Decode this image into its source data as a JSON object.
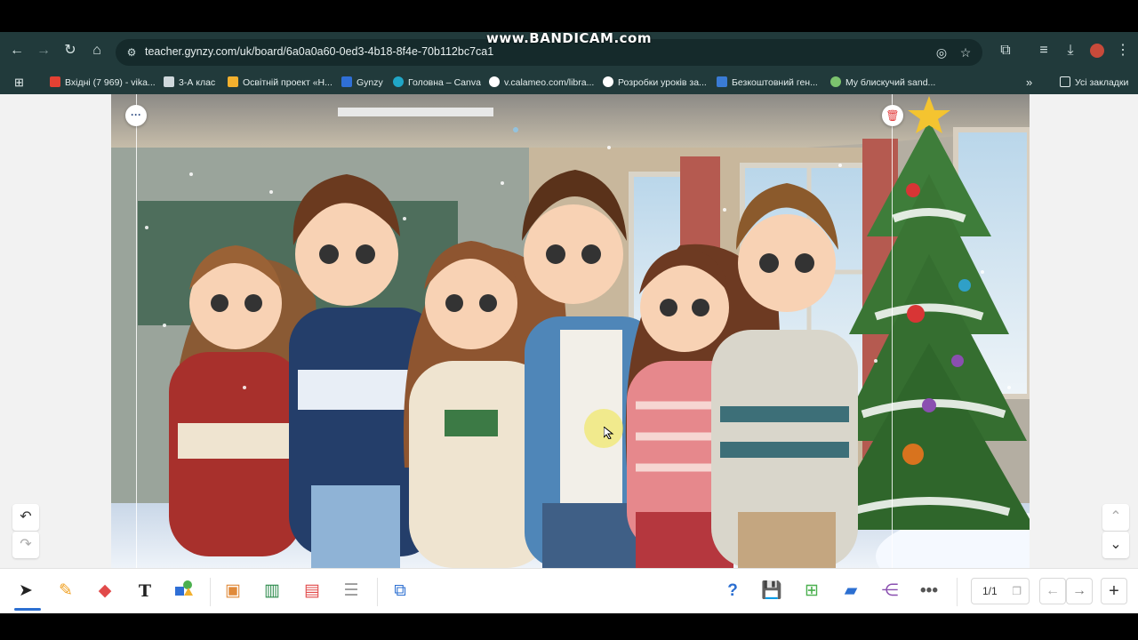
{
  "watermark": "www.BANDICAM.com",
  "browser": {
    "url": "teacher.gynzy.com/uk/board/6a0a0a60-0ed3-4b18-8f4e-70b112bc7ca1",
    "bookmarks": [
      {
        "label": "Вхідні (7 969) - vika...",
        "icon": "gmail-icon",
        "color": "#e34133"
      },
      {
        "label": "3-А клас",
        "icon": "classroom-icon",
        "color": "#cfd8dc"
      },
      {
        "label": "Освітній проект «Н...",
        "icon": "project-icon",
        "color": "#f2b02e"
      },
      {
        "label": "Gynzy",
        "icon": "gynzy-icon",
        "color": "#2f6fd6"
      },
      {
        "label": "Головна – Canva",
        "icon": "canva-icon",
        "color": "#20a6c7"
      },
      {
        "label": "v.calameo.com/libra...",
        "icon": "calameo-icon",
        "color": "#ffffff"
      },
      {
        "label": "Розробки уроків за...",
        "icon": "lessons-icon",
        "color": "#ffffff"
      },
      {
        "label": "Безкоштовний ген...",
        "icon": "generator-icon",
        "color": "#3a7bd5"
      },
      {
        "label": "My блискучий sand...",
        "icon": "sandbox-icon",
        "color": "#7cc36e"
      }
    ],
    "all_bookmarks_label": "Усі закладки"
  },
  "bottom_bar": {
    "page_counter": "1/1"
  },
  "colors": {
    "accent": "#2c6fd1",
    "browser_chrome": "#213a3b"
  }
}
